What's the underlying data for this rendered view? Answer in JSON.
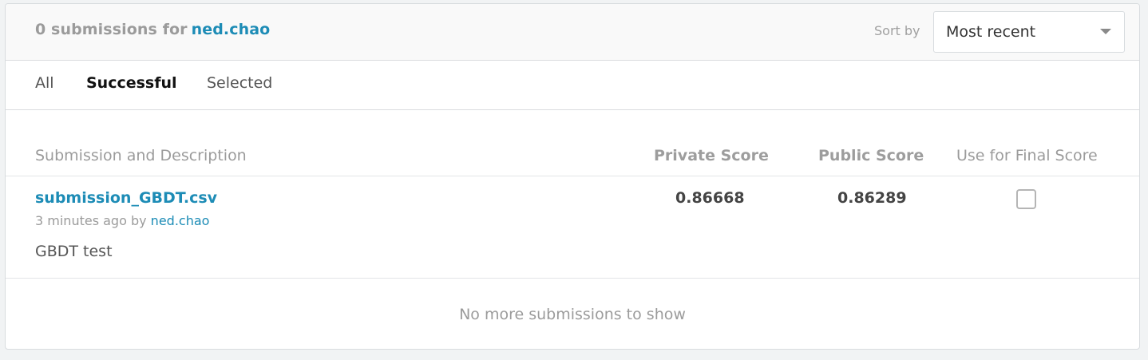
{
  "header": {
    "title_prefix": "0 submissions for",
    "username": "ned.chao",
    "sort_label": "Sort by",
    "sort_value": "Most recent"
  },
  "tabs": [
    {
      "label": "All",
      "active": false
    },
    {
      "label": "Successful",
      "active": true
    },
    {
      "label": "Selected",
      "active": false
    }
  ],
  "table": {
    "columns": {
      "description": "Submission and Description",
      "private_score": "Private Score",
      "public_score": "Public Score",
      "final_score": "Use for Final Score"
    },
    "rows": [
      {
        "filename": "submission_GBDT.csv",
        "time": "3 minutes ago by",
        "author": "ned.chao",
        "description": "GBDT test",
        "private_score": "0.86668",
        "public_score": "0.86289",
        "use_for_final": false
      }
    ],
    "footer": "No more submissions to show"
  },
  "colors": {
    "link": "#1d8cb6",
    "muted": "#9b9b9b",
    "background": "#f1f3f4"
  },
  "icons": {
    "sort_caret": "chevron-down-icon",
    "final_score_checkbox": "checkbox-icon"
  }
}
